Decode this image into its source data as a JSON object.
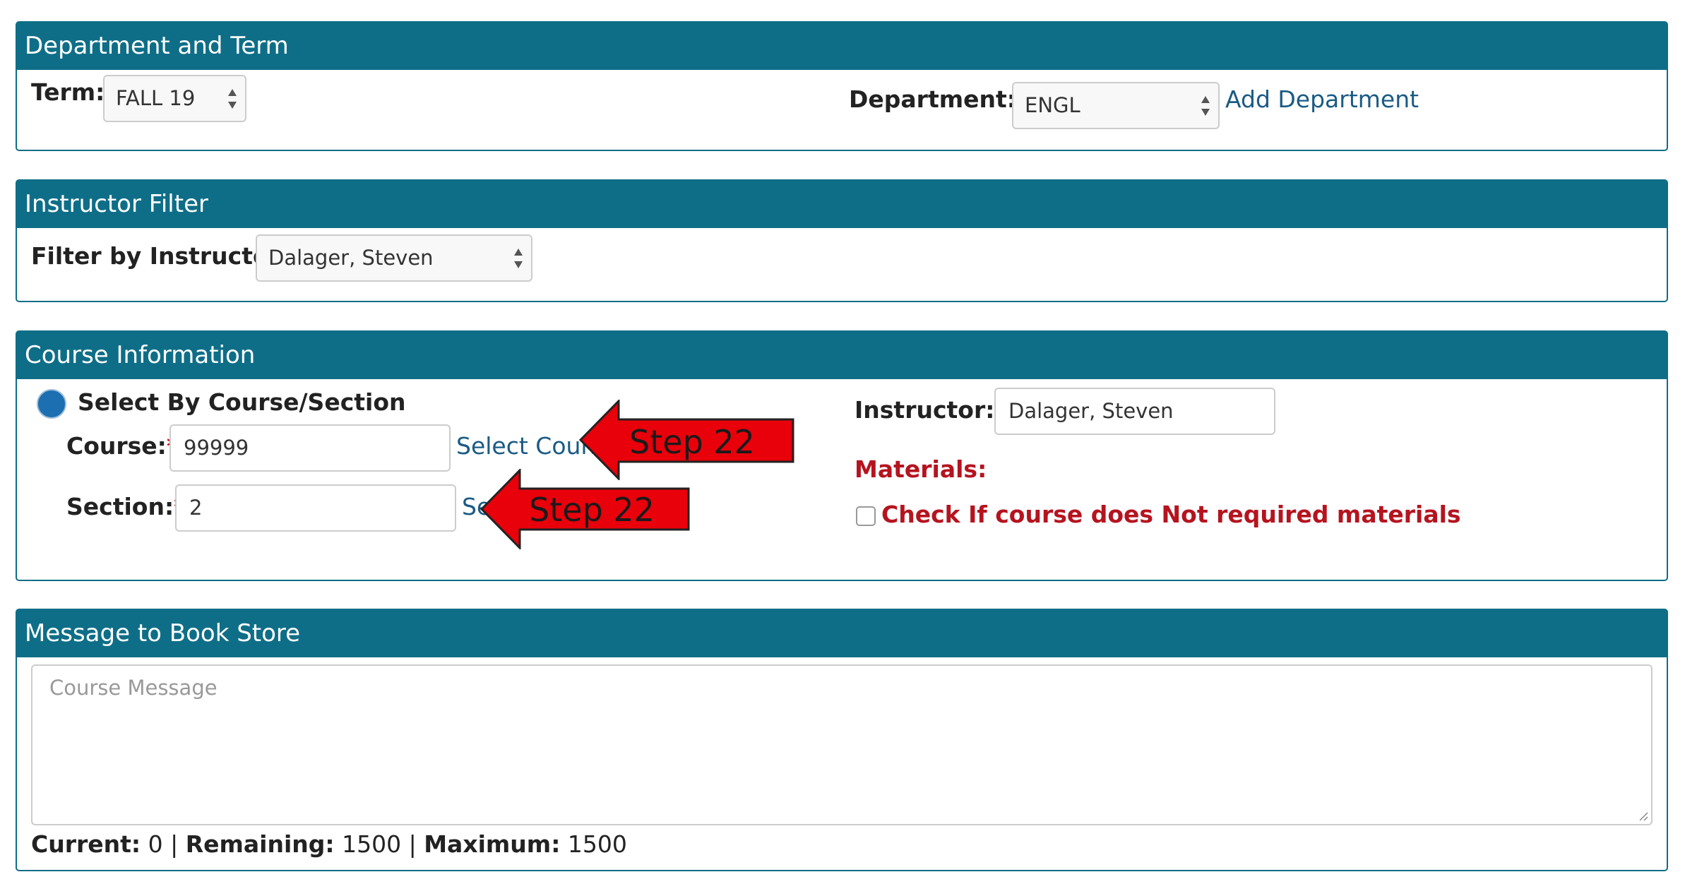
{
  "dept_term": {
    "header": "Department and Term",
    "term_label": "Term:",
    "term_value": "FALL 19",
    "department_label": "Department:",
    "required_mark": "*",
    "department_value": "ENGL",
    "add_department_link": "Add Department"
  },
  "instructor_filter": {
    "header": "Instructor Filter",
    "filter_label": "Filter by Instructor:",
    "filter_value": "Dalager, Steven"
  },
  "course_info": {
    "header": "Course Information",
    "select_by_label": "Select By Course/Section",
    "course_label": "Course:",
    "course_value": "99999",
    "select_course_link": "Select Course",
    "section_label": "Section:",
    "section_value": "2",
    "select_section_link": "Se",
    "instructor_label": "Instructor:",
    "instructor_value": "Dalager, Steven",
    "materials_label": "Materials:",
    "no_materials_label": "Check If course does Not required materials"
  },
  "message": {
    "header": "Message to Book Store",
    "placeholder": "Course Message",
    "current_label": "Current:",
    "current_value": "0",
    "remaining_label": "Remaining:",
    "remaining_value": "1500",
    "maximum_label": "Maximum:",
    "maximum_value": "1500",
    "separator": "|"
  },
  "annotations": {
    "step_course": "Step 22",
    "step_section": "Step 22"
  },
  "colors": {
    "header_bg": "#0f6e87",
    "link": "#1a5b84",
    "required": "#c0192b",
    "materials": "#b5141f",
    "annotation_arrow": "#e8000b"
  },
  "icons": {
    "select_arrows": "updown-caret-icon",
    "radio": "radio-selected-icon",
    "checkbox": "checkbox-unchecked-icon",
    "resize": "resize-grip-icon",
    "annotation": "left-arrow-icon"
  }
}
